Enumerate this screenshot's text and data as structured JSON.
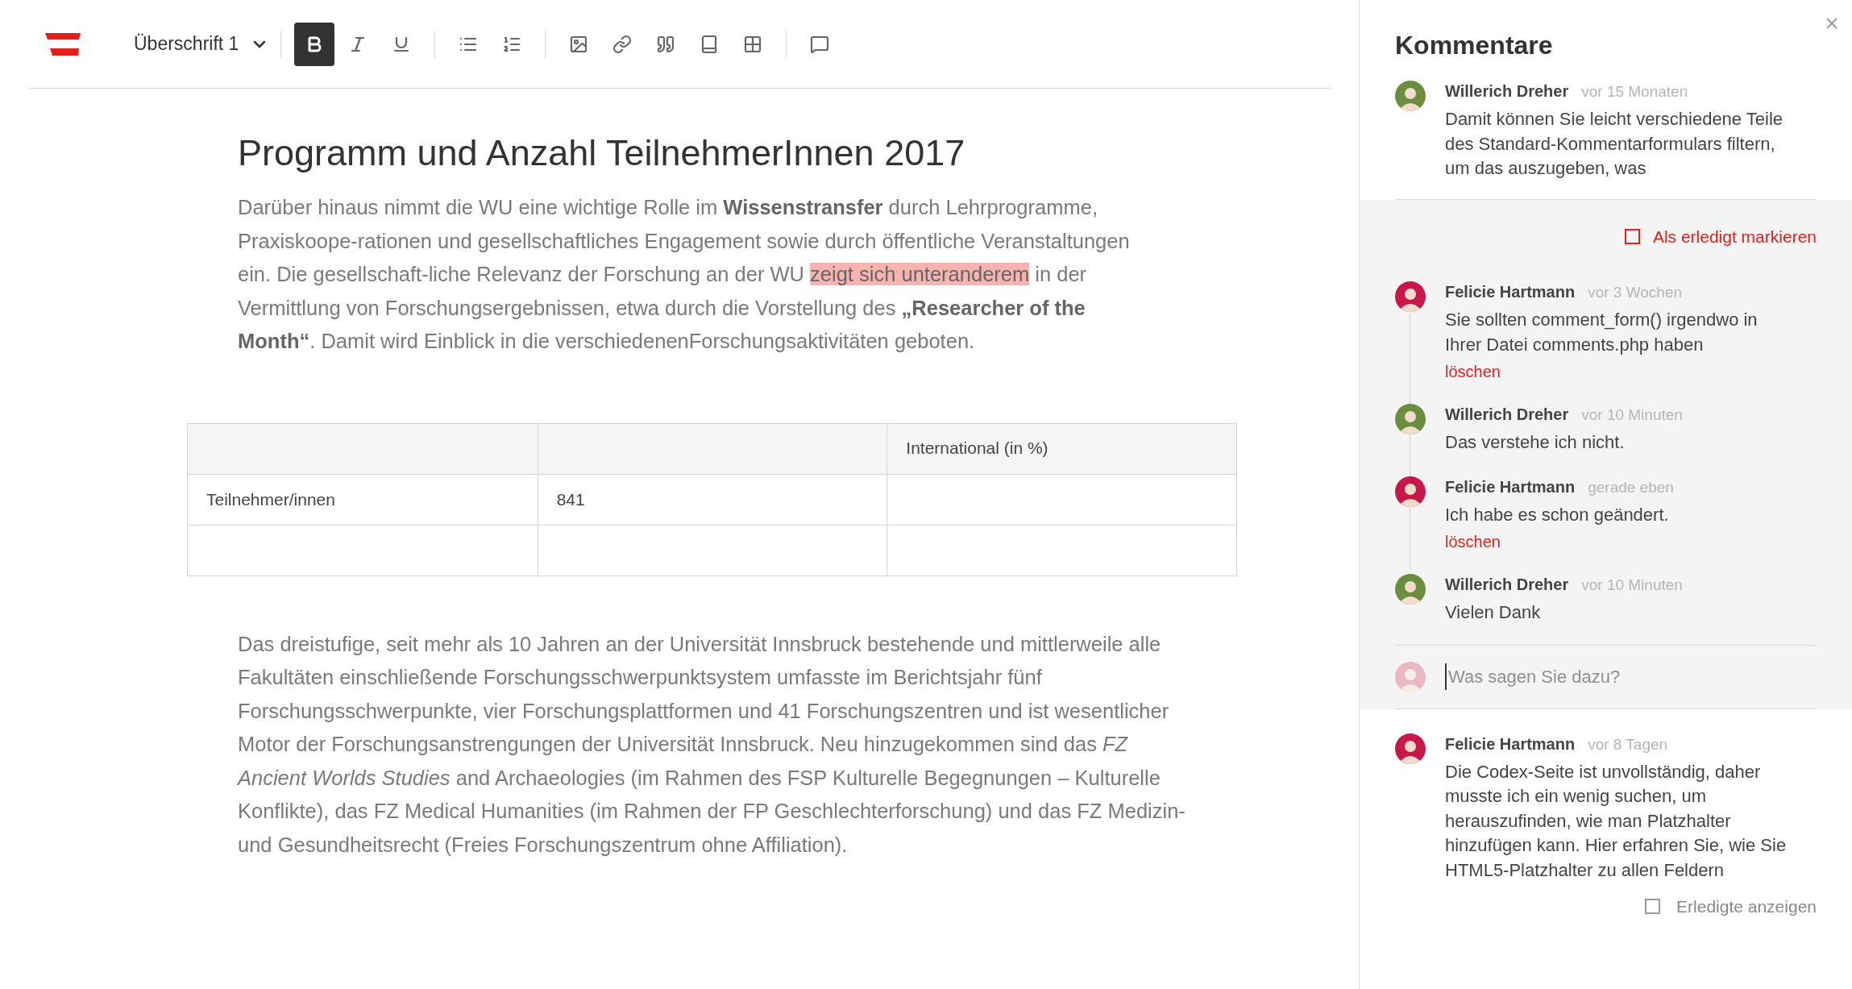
{
  "toolbar": {
    "style_dropdown": "Überschrift 1",
    "groups": [
      [
        {
          "kind": "bold",
          "selected": true
        },
        {
          "kind": "italic",
          "selected": false
        },
        {
          "kind": "underline",
          "selected": false
        }
      ],
      [
        {
          "kind": "bullet-list",
          "selected": false
        },
        {
          "kind": "numbered-list",
          "selected": false
        }
      ],
      [
        {
          "kind": "image",
          "selected": false
        },
        {
          "kind": "link",
          "selected": false
        },
        {
          "kind": "quote",
          "selected": false
        },
        {
          "kind": "book",
          "selected": false
        },
        {
          "kind": "table",
          "selected": false
        }
      ],
      [
        {
          "kind": "comment",
          "selected": false
        }
      ]
    ]
  },
  "document": {
    "heading": "Programm und Anzahl TeilnehmerInnen 2017",
    "paragraph_1": [
      {
        "text": "Darüber hinaus nimmt die WU eine wichtige Rolle im **Wissenstransfer** durch Lehrprogramme, Praxiskoope-rationen und gesellschaftliches Engagement sowie durch öffentliche Veranstaltungen ein. Die gesellschaft-liche Relevanz der Forschung an der WU ",
        "highlighted": false
      },
      {
        "text": "zeigt sich unteranderem",
        "highlighted": true
      },
      {
        "text": " in der Vermittlung von Forschungsergebnissen, etwa durch die Vorstellung des **„Researcher of the Month“**. Damit wird Einblick in die verschiedenenForschungsaktivitäten geboten.",
        "highlighted": false
      }
    ],
    "table": {
      "header": {
        "column_3": "International (in %)"
      },
      "rows": [
        {
          "column_1": "Teilnehmer/innen",
          "column_2": "841"
        }
      ]
    },
    "paragraph_2": [
      {
        "text": "Das dreistufige, seit mehr als 10 Jahren an der Universität Innsbruck bestehende und mittlerweile alle Fakultäten einschließende Forschungsschwerpunktsystem umfasste im Berichtsjahr fünf Forschungsschwerpunkte, vier Forschungsplattformen und 41 Forschungszentren und ist wesentlicher Motor der Forschungsanstrengungen der Universität Innsbruck. Neu hinzugekommen sind das *FZ Ancient Worlds Studies* and Archaeologies (im Rahmen des FSP Kulturelle Begegnungen – Kulturelle Konflikte), das FZ Medical Humanities (im Rahmen der FP Geschlechterforschung) und das FZ Medizin- und Gesundheitsrecht (Freies Forschungszentrum ohne Affiliation).",
        "highlighted": false
      }
    ]
  },
  "sidebar": {
    "title": "Kommentare",
    "first_comment": {
      "author": "Willerich Dreher",
      "time": "vor 15 Monaten",
      "text": "Damit können Sie leicht verschiedene Teile des Standard-Kommentarformulars filtern, um das auszugeben, was",
      "color": "#6b8e3e"
    },
    "thread": {
      "resolve_label": "Als erledigt markieren",
      "resolved": false,
      "replies": [
        {
          "author": "Felicie Hartmann",
          "time": "vor 3 Wochen",
          "text": "Sie sollten comment_form() irgendwo in Ihrer Datei comments.php haben",
          "color": "#c8174a",
          "delete_label": "löschen"
        },
        {
          "author": "Willerich Dreher",
          "time": "vor 10 Minuten",
          "text": "Das verstehe ich nicht.",
          "color": "#6b8e3e"
        },
        {
          "author": "Felicie Hartmann",
          "time": "gerade eben",
          "text": "Ich habe es schon geändert.",
          "color": "#c8174a",
          "delete_label": "löschen"
        },
        {
          "author": "Willerich Dreher",
          "time": "vor 10 Minuten",
          "text": "Vielen Dank",
          "color": "#6b8e3e"
        }
      ],
      "reply_placeholder": "Was sagen Sie dazu?"
    },
    "last_comment": {
      "author": "Felicie Hartmann",
      "time": "vor 8 Tagen",
      "text": "Die Codex-Seite ist unvollständig, daher musste ich ein wenig suchen, um herauszufinden, wie man Platzhalter hinzufügen kann. Hier erfahren Sie, wie Sie HTML5-Platzhalter zu allen Feldern",
      "color": "#c8174a"
    },
    "show_resolved": {
      "label": "Erledigte anzeigen",
      "checked": false
    }
  }
}
